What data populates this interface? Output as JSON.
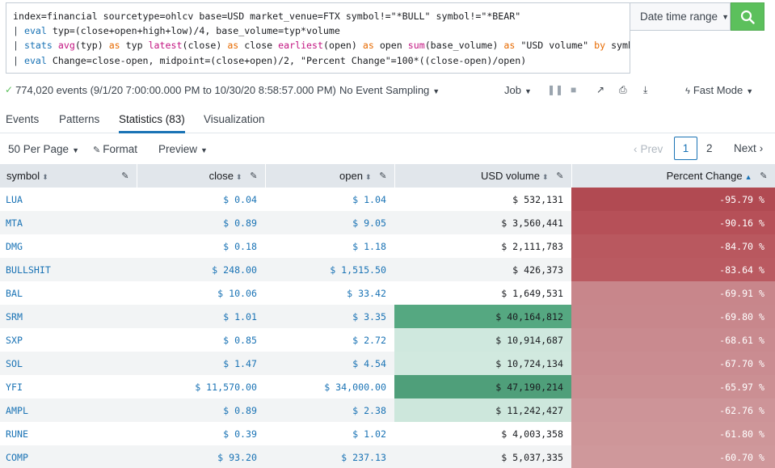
{
  "search": {
    "line1": "index=financial sourcetype=ohlcv base=USD market_venue=FTX symbol!=\"*BULL\" symbol!=\"*BEAR\"",
    "line2_pipe": "| ",
    "line2_cmd": "eval",
    "line2_rest": " typ=(close+open+high+low)/4, base_volume=typ*volume",
    "line3_pipe": "| ",
    "line3_cmd": "stats",
    "line3_fn1": "avg",
    "line3_t1": "(typ) ",
    "line3_as1": "as",
    "line3_t2": " typ ",
    "line3_fn2": "latest",
    "line3_t3": "(close) ",
    "line3_as2": "as",
    "line3_t4": " close ",
    "line3_fn3": "earliest",
    "line3_t5": "(open) ",
    "line3_as3": "as",
    "line3_t6": " open ",
    "line3_fn4": "sum",
    "line3_t7": "(base_volume) ",
    "line3_as4": "as",
    "line3_t8": " \"USD volume\" ",
    "line3_by": "by",
    "line3_t9": " symbol",
    "line4_pipe": "| ",
    "line4_cmd": "eval",
    "line4_rest": " Change=close-open, midpoint=(close+open)/2, \"Percent Change\"=100*((close-open)/open)",
    "date_range_label": "Date time range"
  },
  "status": {
    "events": "774,020 events (9/1/20 7:00:00.000 PM to 10/30/20 8:58:57.000 PM)",
    "sampling": "No Event Sampling",
    "job": "Job",
    "mode": "Fast Mode"
  },
  "tabs": [
    {
      "label": "Events"
    },
    {
      "label": "Patterns"
    },
    {
      "label": "Statistics (83)"
    },
    {
      "label": "Visualization"
    }
  ],
  "controls": {
    "per_page": "50 Per Page",
    "format": "Format",
    "preview": "Preview",
    "prev": "Prev",
    "next": "Next",
    "page1": "1",
    "page2": "2"
  },
  "table": {
    "columns": [
      "symbol",
      "close",
      "open",
      "USD volume",
      "Percent Change"
    ],
    "rows": [
      {
        "symbol": "LUA",
        "close": "$ 0.04",
        "open": "$ 1.04",
        "volume": "$ 532,131",
        "pct": "-95.79 %",
        "vol_color": "",
        "pct_color": "#b14a52"
      },
      {
        "symbol": "MTA",
        "close": "$ 0.89",
        "open": "$ 9.05",
        "volume": "$ 3,560,441",
        "pct": "-90.16 %",
        "vol_color": "",
        "pct_color": "#b65058"
      },
      {
        "symbol": "DMG",
        "close": "$ 0.18",
        "open": "$ 1.18",
        "volume": "$ 2,111,783",
        "pct": "-84.70 %",
        "vol_color": "",
        "pct_color": "#b9585f"
      },
      {
        "symbol": "BULLSHIT",
        "close": "$ 248.00",
        "open": "$ 1,515.50",
        "volume": "$ 426,373",
        "pct": "-83.64 %",
        "vol_color": "",
        "pct_color": "#ba5a61"
      },
      {
        "symbol": "BAL",
        "close": "$ 10.06",
        "open": "$ 33.42",
        "volume": "$ 1,649,531",
        "pct": "-69.91 %",
        "vol_color": "",
        "pct_color": "#c8868b"
      },
      {
        "symbol": "SRM",
        "close": "$ 1.01",
        "open": "$ 3.35",
        "volume": "$ 40,164,812",
        "pct": "-69.80 %",
        "vol_color": "#55a881",
        "pct_color": "#c8878c"
      },
      {
        "symbol": "SXP",
        "close": "$ 0.85",
        "open": "$ 2.72",
        "volume": "$ 10,914,687",
        "pct": "-68.61 %",
        "vol_color": "#cfe8de",
        "pct_color": "#c98a8f"
      },
      {
        "symbol": "SOL",
        "close": "$ 1.47",
        "open": "$ 4.54",
        "volume": "$ 10,724,134",
        "pct": "-67.70 %",
        "vol_color": "#d1e9df",
        "pct_color": "#ca8c91"
      },
      {
        "symbol": "YFI",
        "close": "$ 11,570.00",
        "open": "$ 34,000.00",
        "volume": "$ 47,190,214",
        "pct": "-65.97 %",
        "vol_color": "#4f9f7a",
        "pct_color": "#cb8f93"
      },
      {
        "symbol": "AMPL",
        "close": "$ 0.89",
        "open": "$ 2.38",
        "volume": "$ 11,242,427",
        "pct": "-62.76 %",
        "vol_color": "#cde7dc",
        "pct_color": "#cd9498"
      },
      {
        "symbol": "RUNE",
        "close": "$ 0.39",
        "open": "$ 1.02",
        "volume": "$ 4,003,358",
        "pct": "-61.80 %",
        "vol_color": "",
        "pct_color": "#ce9699"
      },
      {
        "symbol": "COMP",
        "close": "$ 93.20",
        "open": "$ 237.13",
        "volume": "$ 5,037,335",
        "pct": "-60.70 %",
        "vol_color": "",
        "pct_color": "#cf989b"
      }
    ]
  }
}
